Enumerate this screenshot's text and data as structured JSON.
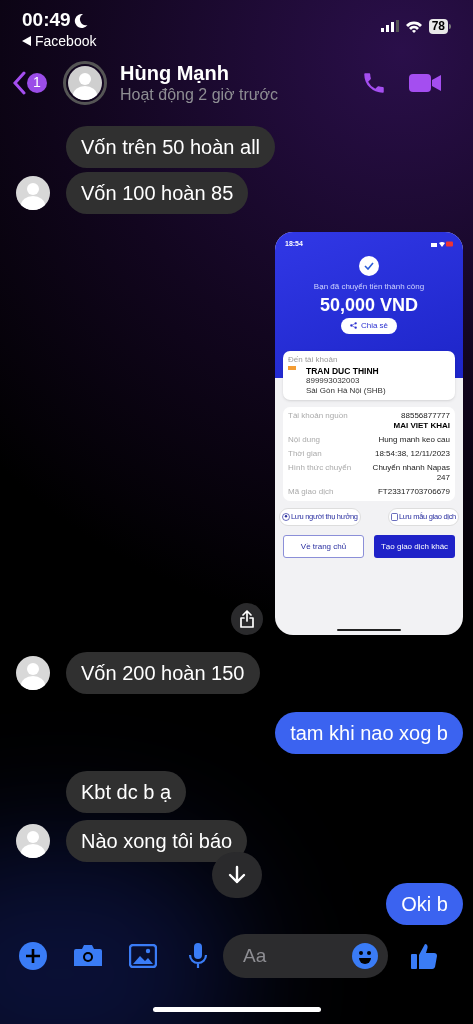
{
  "status_bar": {
    "time": "00:49",
    "back_app": "Facebook",
    "battery": "78"
  },
  "header": {
    "badge": "1",
    "name": "Hùng Mạnh",
    "status": "Hoạt động 2 giờ trước"
  },
  "messages": [
    {
      "kind": "text",
      "outgoing": false,
      "avatar": false,
      "text": "Vốn trên 50 hoàn all"
    },
    {
      "kind": "text",
      "outgoing": false,
      "avatar": true,
      "text": "Vốn 100 hoàn 85"
    },
    {
      "kind": "image",
      "outgoing": true,
      "avatar": false,
      "receipt": {
        "time": "18:54",
        "title": "Bạn đã chuyển tiền thành công",
        "amount": "50,000 VND",
        "share": "Chia sẻ",
        "to_label": "Đến tài khoản",
        "recipient": "TRAN DUC THINH",
        "account": "899993032003",
        "bank": "Sài Gòn Hà Nội (SHB)",
        "details": [
          {
            "label": "Tài khoản nguồn",
            "value": "88556877777",
            "value_bold": "MAI VIET KHAI"
          },
          {
            "label": "Nội dung",
            "value": "Hung manh keo cau"
          },
          {
            "label": "Thời gian",
            "value": "18:54:38, 12/11/2023"
          },
          {
            "label": "Hình thức chuyển",
            "value": "Chuyển nhanh Napas 247"
          },
          {
            "label": "Mã giao dịch",
            "value": "FT23317703706679"
          }
        ],
        "save_buttons": [
          "Lưu người thụ hưởng",
          "Lưu mẫu giao dịch"
        ],
        "home_button": "Về trang chủ",
        "new_button": "Tạo giao dịch khác"
      }
    },
    {
      "kind": "text",
      "outgoing": false,
      "avatar": true,
      "text": "Vốn 200 hoàn 150"
    },
    {
      "kind": "text",
      "outgoing": true,
      "avatar": false,
      "text": "tam khi nao xog b"
    },
    {
      "kind": "text",
      "outgoing": false,
      "avatar": false,
      "text": "Kbt dc b ạ"
    },
    {
      "kind": "text",
      "outgoing": false,
      "avatar": true,
      "text": "Nào xong tôi báo"
    },
    {
      "kind": "text",
      "outgoing": true,
      "avatar": false,
      "text": "Oki b"
    }
  ],
  "composer": {
    "placeholder": "Aa"
  }
}
